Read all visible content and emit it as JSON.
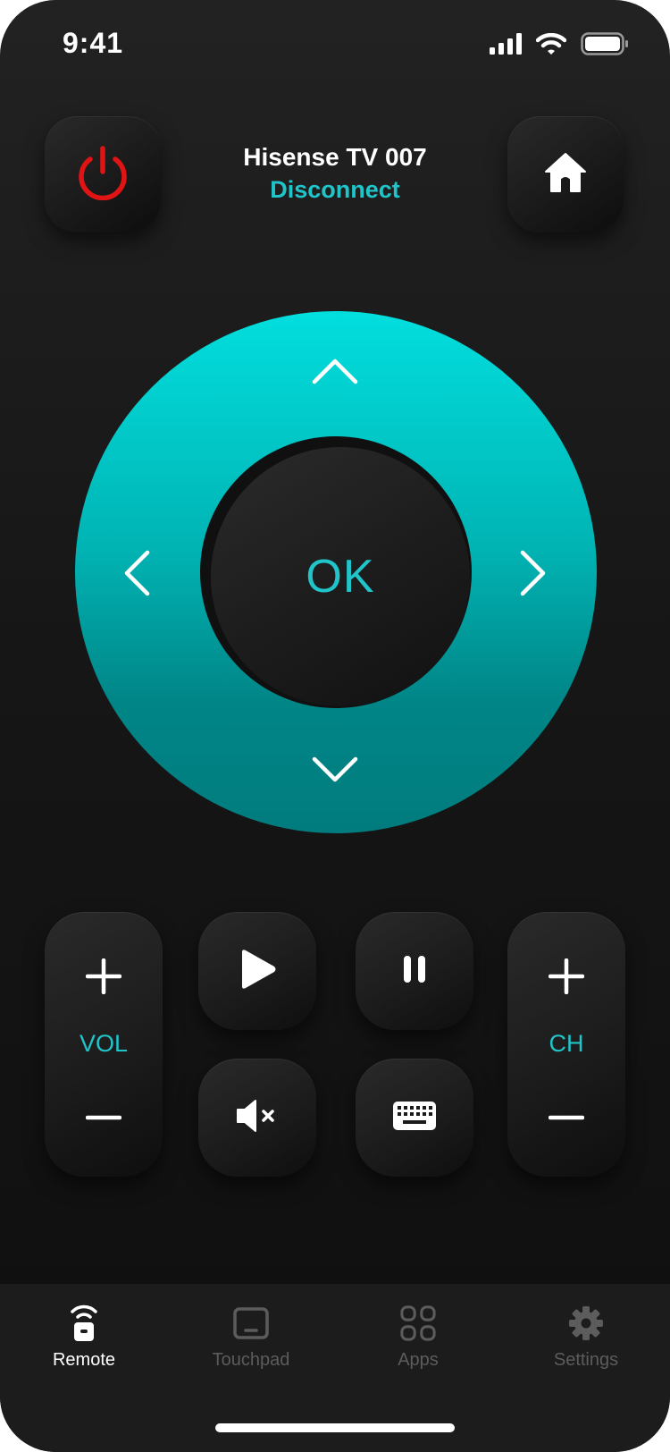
{
  "status_bar": {
    "time": "9:41",
    "icons": [
      "cellular-signal-icon",
      "wifi-icon",
      "battery-icon"
    ]
  },
  "header": {
    "device_name": "Hisense TV 007",
    "disconnect_label": "Disconnect",
    "power_icon": "power-icon",
    "home_icon": "home-icon"
  },
  "dpad": {
    "ok_label": "OK",
    "up_icon": "chevron-up-icon",
    "down_icon": "chevron-down-icon",
    "left_icon": "chevron-left-icon",
    "right_icon": "chevron-right-icon"
  },
  "controls": {
    "volume": {
      "label": "VOL",
      "up_icon": "plus-icon",
      "down_icon": "minus-icon"
    },
    "channel": {
      "label": "CH",
      "up_icon": "plus-icon",
      "down_icon": "minus-icon"
    },
    "play_icon": "play-icon",
    "pause_icon": "pause-icon",
    "mute_icon": "mute-icon",
    "keyboard_icon": "keyboard-icon"
  },
  "tabbar": {
    "tabs": [
      {
        "label": "Remote",
        "icon": "remote-icon",
        "active": true
      },
      {
        "label": "Touchpad",
        "icon": "touchpad-icon",
        "active": false
      },
      {
        "label": "Apps",
        "icon": "apps-grid-icon",
        "active": false
      },
      {
        "label": "Settings",
        "icon": "gear-icon",
        "active": false
      }
    ]
  },
  "colors": {
    "accent": "#1fc5c9",
    "power": "#e01414",
    "background": "#141414",
    "tab_inactive": "#5c5c5c"
  }
}
